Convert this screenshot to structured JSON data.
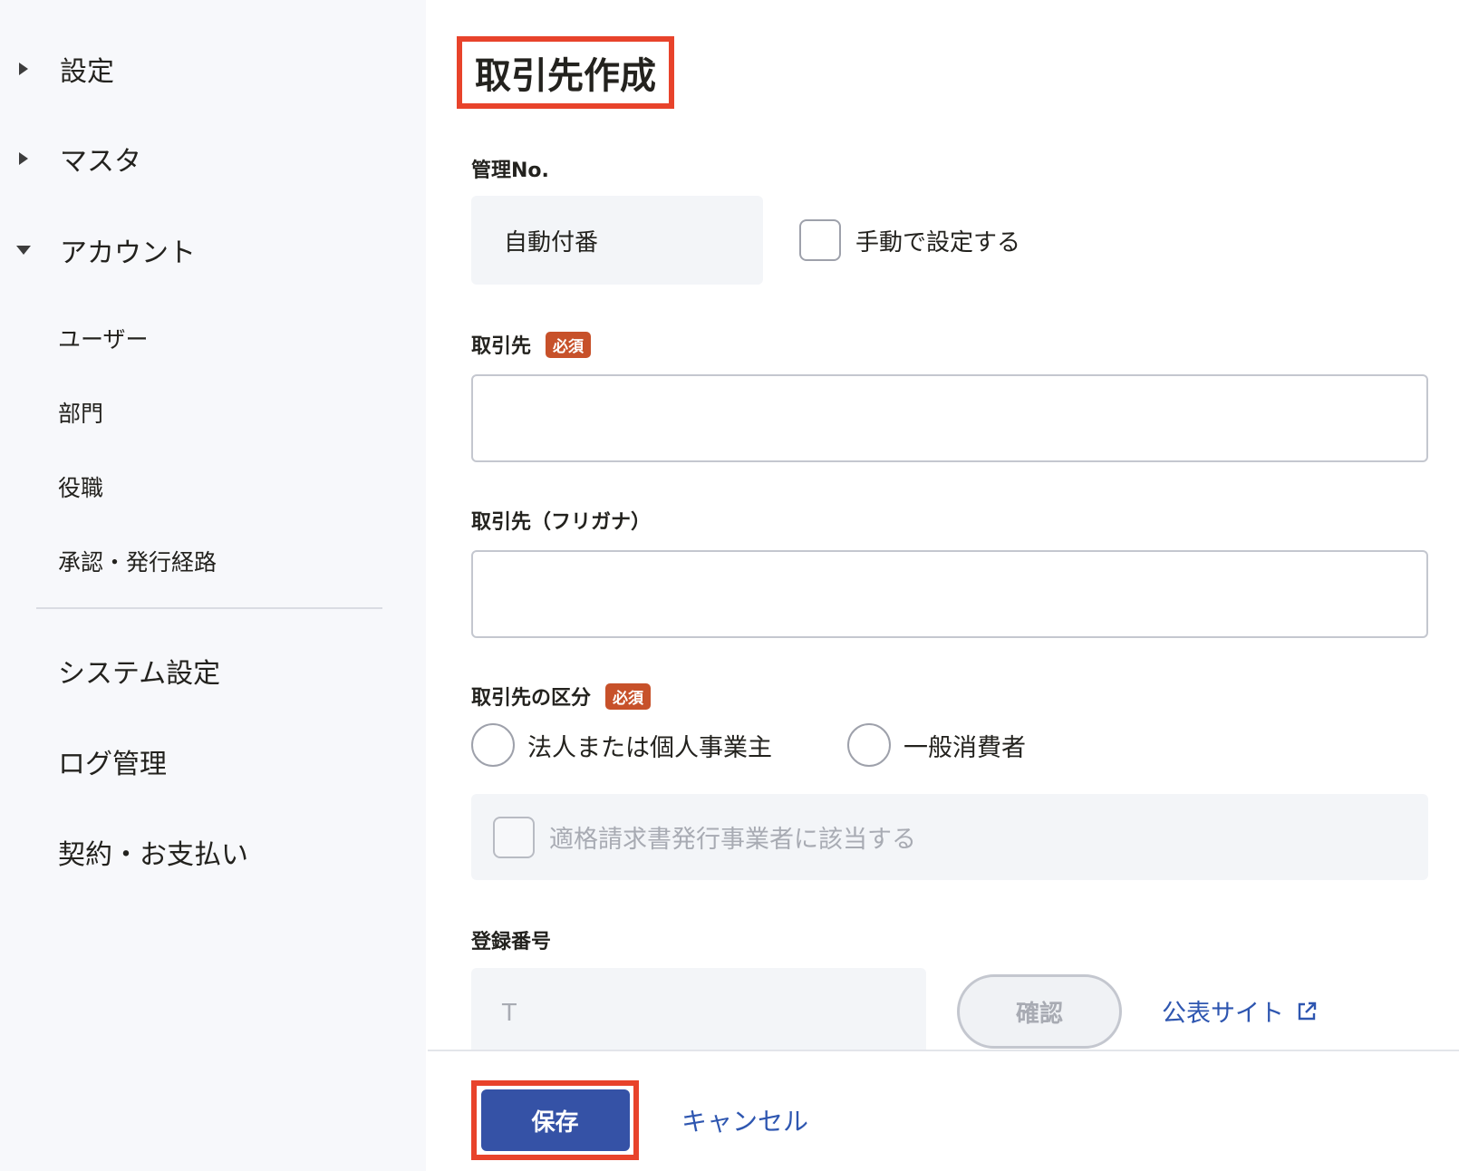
{
  "sidebar": {
    "groups": [
      {
        "label": "設定",
        "expanded": false
      },
      {
        "label": "マスタ",
        "expanded": false
      },
      {
        "label": "アカウント",
        "expanded": true
      }
    ],
    "account_items": [
      "ユーザー",
      "部門",
      "役職",
      "承認・発行経路"
    ],
    "bottom_items": [
      "システム設定",
      "ログ管理",
      "契約・お支払い"
    ]
  },
  "page": {
    "title": "取引先作成"
  },
  "form": {
    "mgmt_no": {
      "label": "管理No.",
      "auto_value": "自動付番",
      "manual_checkbox_label": "手動で設定する"
    },
    "required_badge": "必須",
    "partner": {
      "label": "取引先",
      "value": ""
    },
    "partner_kana": {
      "label": "取引先（フリガナ）",
      "value": ""
    },
    "partner_type": {
      "label": "取引先の区分",
      "options": [
        "法人または個人事業主",
        "一般消費者"
      ]
    },
    "invoice_checkbox_label": "適格請求書発行事業者に該当する",
    "registration": {
      "label": "登録番号",
      "prefix": "T",
      "confirm_label": "確認",
      "public_site_label": "公表サイト"
    }
  },
  "footer": {
    "save_label": "保存",
    "cancel_label": "キャンセル"
  },
  "colors": {
    "accent": "#3552a6",
    "link": "#2e56b0",
    "highlight": "#e8432b",
    "required_badge": "#c7512a"
  }
}
